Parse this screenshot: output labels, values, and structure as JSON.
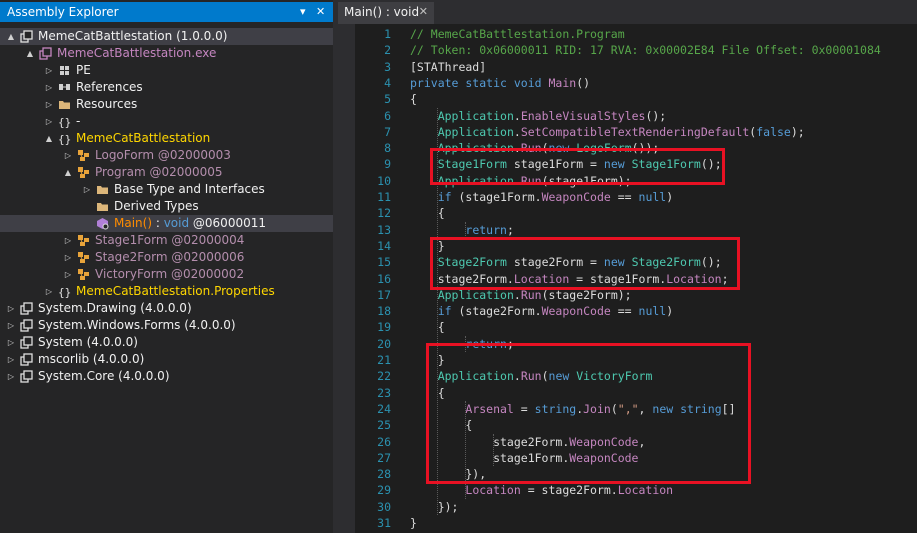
{
  "left_panel": {
    "title": "Assembly Explorer",
    "pin_glyph": "▾",
    "close_glyph": "✕",
    "tree": [
      {
        "label": "MemeCatBattlestation (1.0.0.0)",
        "cls": "",
        "indent": 0,
        "twisty": "▲",
        "icon": "assembly-icon",
        "selected": true
      },
      {
        "label": "MemeCatBattlestation.exe",
        "cls": "lp",
        "indent": 1,
        "twisty": "▲",
        "icon": "module-icon",
        "selected": false
      },
      {
        "label": "PE",
        "cls": "",
        "indent": 2,
        "twisty": "▷",
        "icon": "pe-icon",
        "selected": false
      },
      {
        "label": "References",
        "cls": "",
        "indent": 2,
        "twisty": "▷",
        "icon": "references-icon",
        "selected": false
      },
      {
        "label": "Resources",
        "cls": "",
        "indent": 2,
        "twisty": "▷",
        "icon": "folder-icon",
        "selected": false
      },
      {
        "label": "-",
        "cls": "",
        "indent": 2,
        "twisty": "▷",
        "icon": "namespace-icon",
        "selected": false
      },
      {
        "label": "MemeCatBattlestation",
        "cls": "y",
        "indent": 2,
        "twisty": "▲",
        "icon": "namespace-icon",
        "selected": false
      },
      {
        "label": "LogoForm @02000003",
        "cls": "p",
        "indent": 3,
        "twisty": "▷",
        "icon": "class-icon",
        "selected": false
      },
      {
        "label": "Program @02000005",
        "cls": "p",
        "indent": 3,
        "twisty": "▲",
        "icon": "class-icon",
        "selected": false
      },
      {
        "label": "Base Type and Interfaces",
        "cls": "",
        "indent": 4,
        "twisty": "▷",
        "icon": "folder-icon",
        "selected": false
      },
      {
        "label": "Derived Types",
        "cls": "",
        "indent": 4,
        "twisty": "",
        "icon": "folder-icon",
        "selected": false
      },
      {
        "label": "Main() : void @06000011",
        "cls": "o",
        "indent": 4,
        "twisty": "",
        "icon": "method-icon",
        "selected": true
      },
      {
        "label": "Stage1Form @02000004",
        "cls": "p",
        "indent": 3,
        "twisty": "▷",
        "icon": "class-icon",
        "selected": false
      },
      {
        "label": "Stage2Form @02000006",
        "cls": "p",
        "indent": 3,
        "twisty": "▷",
        "icon": "class-icon",
        "selected": false
      },
      {
        "label": "VictoryForm @02000002",
        "cls": "p",
        "indent": 3,
        "twisty": "▷",
        "icon": "class-icon",
        "selected": false
      },
      {
        "label": "MemeCatBattlestation.Properties",
        "cls": "y",
        "indent": 2,
        "twisty": "▷",
        "icon": "namespace-icon",
        "selected": false
      },
      {
        "label": "System.Drawing (4.0.0.0)",
        "cls": "",
        "indent": 0,
        "twisty": "▷",
        "icon": "assembly-icon",
        "selected": false
      },
      {
        "label": "System.Windows.Forms (4.0.0.0)",
        "cls": "",
        "indent": 0,
        "twisty": "▷",
        "icon": "assembly-icon",
        "selected": false
      },
      {
        "label": "System (4.0.0.0)",
        "cls": "",
        "indent": 0,
        "twisty": "▷",
        "icon": "assembly-icon",
        "selected": false
      },
      {
        "label": "mscorlib (4.0.0.0)",
        "cls": "",
        "indent": 0,
        "twisty": "▷",
        "icon": "assembly-icon",
        "selected": false
      },
      {
        "label": "System.Core (4.0.0.0)",
        "cls": "",
        "indent": 0,
        "twisty": "▷",
        "icon": "assembly-icon",
        "selected": false
      }
    ]
  },
  "tab": {
    "title": "Main() : void",
    "close_glyph": "✕"
  },
  "code_lines": [
    [
      [
        "cm",
        "// MemeCatBattlestation.Program"
      ]
    ],
    [
      [
        "cm",
        "// Token: 0x06000011 RID: 17 RVA: 0x00002E84 File Offset: 0x00001084"
      ]
    ],
    [
      [
        "",
        "[STAThread]"
      ]
    ],
    [
      [
        "kw",
        "private static void "
      ],
      [
        "me",
        "Main"
      ],
      [
        "",
        "()"
      ]
    ],
    [
      [
        "",
        "{"
      ]
    ],
    [
      [
        "",
        "    "
      ],
      [
        "ty",
        "Application"
      ],
      [
        "",
        "."
      ],
      [
        "me",
        "EnableVisualStyles"
      ],
      [
        "",
        "();"
      ]
    ],
    [
      [
        "",
        "    "
      ],
      [
        "ty",
        "Application"
      ],
      [
        "",
        "."
      ],
      [
        "me",
        "SetCompatibleTextRenderingDefault"
      ],
      [
        "",
        "("
      ],
      [
        "kw",
        "false"
      ],
      [
        "",
        ");"
      ]
    ],
    [
      [
        "",
        "    "
      ],
      [
        "ty",
        "Application"
      ],
      [
        "",
        "."
      ],
      [
        "me",
        "Run"
      ],
      [
        "",
        "("
      ],
      [
        "kw",
        "new "
      ],
      [
        "ty",
        "LogoForm"
      ],
      [
        "",
        "());"
      ]
    ],
    [
      [
        "",
        "    "
      ],
      [
        "ty",
        "Stage1Form"
      ],
      [
        "",
        " stage1Form = "
      ],
      [
        "kw",
        "new "
      ],
      [
        "ty",
        "Stage1Form"
      ],
      [
        "",
        "();"
      ]
    ],
    [
      [
        "",
        "    "
      ],
      [
        "ty",
        "Application"
      ],
      [
        "",
        "."
      ],
      [
        "me",
        "Run"
      ],
      [
        "",
        "(stage1Form);"
      ]
    ],
    [
      [
        "",
        "    "
      ],
      [
        "kw",
        "if"
      ],
      [
        "",
        " (stage1Form."
      ],
      [
        "pr",
        "WeaponCode"
      ],
      [
        "",
        " == "
      ],
      [
        "kw",
        "null"
      ],
      [
        "",
        ")"
      ]
    ],
    [
      [
        "",
        "    {"
      ]
    ],
    [
      [
        "",
        "        "
      ],
      [
        "kw",
        "return"
      ],
      [
        "",
        ";"
      ]
    ],
    [
      [
        "",
        "    }"
      ]
    ],
    [
      [
        "",
        "    "
      ],
      [
        "ty",
        "Stage2Form"
      ],
      [
        "",
        " stage2Form = "
      ],
      [
        "kw",
        "new "
      ],
      [
        "ty",
        "Stage2Form"
      ],
      [
        "",
        "();"
      ]
    ],
    [
      [
        "",
        "    stage2Form."
      ],
      [
        "pr",
        "Location"
      ],
      [
        "",
        " = stage1Form."
      ],
      [
        "pr",
        "Location"
      ],
      [
        "",
        ";"
      ]
    ],
    [
      [
        "",
        "    "
      ],
      [
        "ty",
        "Application"
      ],
      [
        "",
        "."
      ],
      [
        "me",
        "Run"
      ],
      [
        "",
        "(stage2Form);"
      ]
    ],
    [
      [
        "",
        "    "
      ],
      [
        "kw",
        "if"
      ],
      [
        "",
        " (stage2Form."
      ],
      [
        "pr",
        "WeaponCode"
      ],
      [
        "",
        " == "
      ],
      [
        "kw",
        "null"
      ],
      [
        "",
        ")"
      ]
    ],
    [
      [
        "",
        "    {"
      ]
    ],
    [
      [
        "",
        "        "
      ],
      [
        "kw",
        "return"
      ],
      [
        "",
        ";"
      ]
    ],
    [
      [
        "",
        "    }"
      ]
    ],
    [
      [
        "",
        "    "
      ],
      [
        "ty",
        "Application"
      ],
      [
        "",
        "."
      ],
      [
        "me",
        "Run"
      ],
      [
        "",
        "("
      ],
      [
        "kw",
        "new "
      ],
      [
        "ty",
        "VictoryForm"
      ]
    ],
    [
      [
        "",
        "    {"
      ]
    ],
    [
      [
        "",
        "        "
      ],
      [
        "pr",
        "Arsenal"
      ],
      [
        "",
        " = "
      ],
      [
        "kw",
        "string"
      ],
      [
        "",
        "."
      ],
      [
        "me",
        "Join"
      ],
      [
        "",
        "("
      ],
      [
        "st",
        "\",\""
      ],
      [
        "",
        ", "
      ],
      [
        "kw",
        "new string"
      ],
      [
        "",
        "[]"
      ]
    ],
    [
      [
        "",
        "        {"
      ]
    ],
    [
      [
        "",
        "            stage2Form."
      ],
      [
        "pr",
        "WeaponCode"
      ],
      [
        "",
        ","
      ]
    ],
    [
      [
        "",
        "            stage1Form."
      ],
      [
        "pr",
        "WeaponCode"
      ]
    ],
    [
      [
        "",
        "        }),"
      ]
    ],
    [
      [
        "",
        "        "
      ],
      [
        "pr",
        "Location"
      ],
      [
        "",
        " = stage2Form."
      ],
      [
        "pr",
        "Location"
      ]
    ],
    [
      [
        "",
        "    });"
      ]
    ],
    [
      [
        "",
        "}"
      ]
    ],
    [
      [
        "",
        ""
      ]
    ]
  ],
  "highlight_color": "#e81123"
}
